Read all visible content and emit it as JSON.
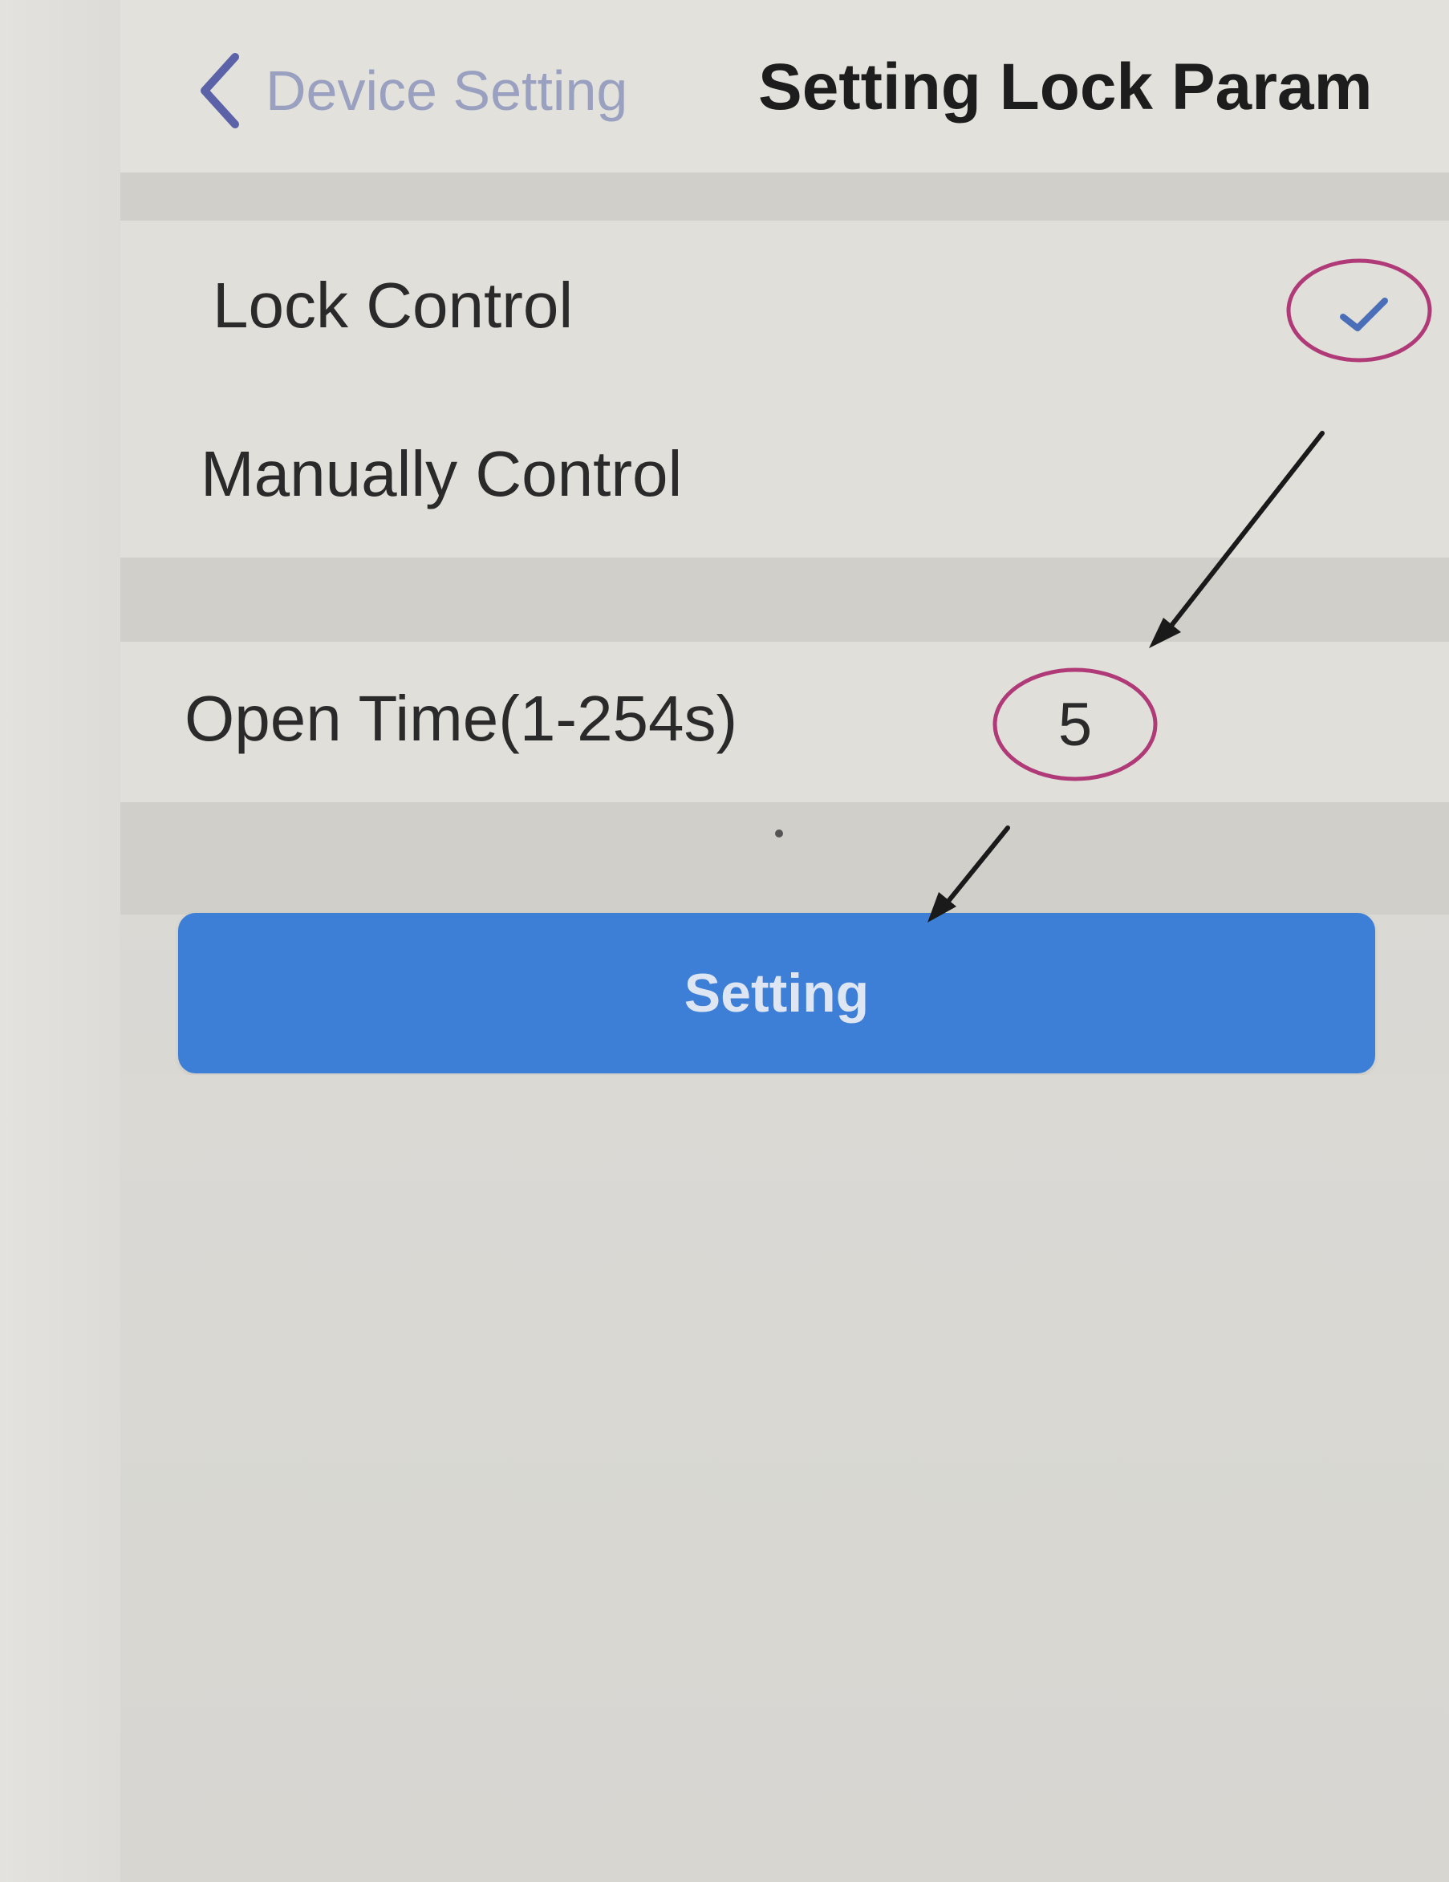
{
  "nav": {
    "back_label": "Device Setting",
    "title": "Setting Lock Param",
    "back_icon": "chevron-left-icon"
  },
  "lock_options": [
    {
      "label": "Lock Control",
      "selected": true
    },
    {
      "label": "Manually Control",
      "selected": false
    }
  ],
  "open_time": {
    "label": "Open Time(1-254s)",
    "value": "5"
  },
  "setting_button": {
    "label": "Setting"
  },
  "colors": {
    "accent": "#3d7fd6",
    "check": "#4a6fb8",
    "annotation_circle": "#b03a78",
    "annotation_arrow": "#1a1a1a"
  }
}
